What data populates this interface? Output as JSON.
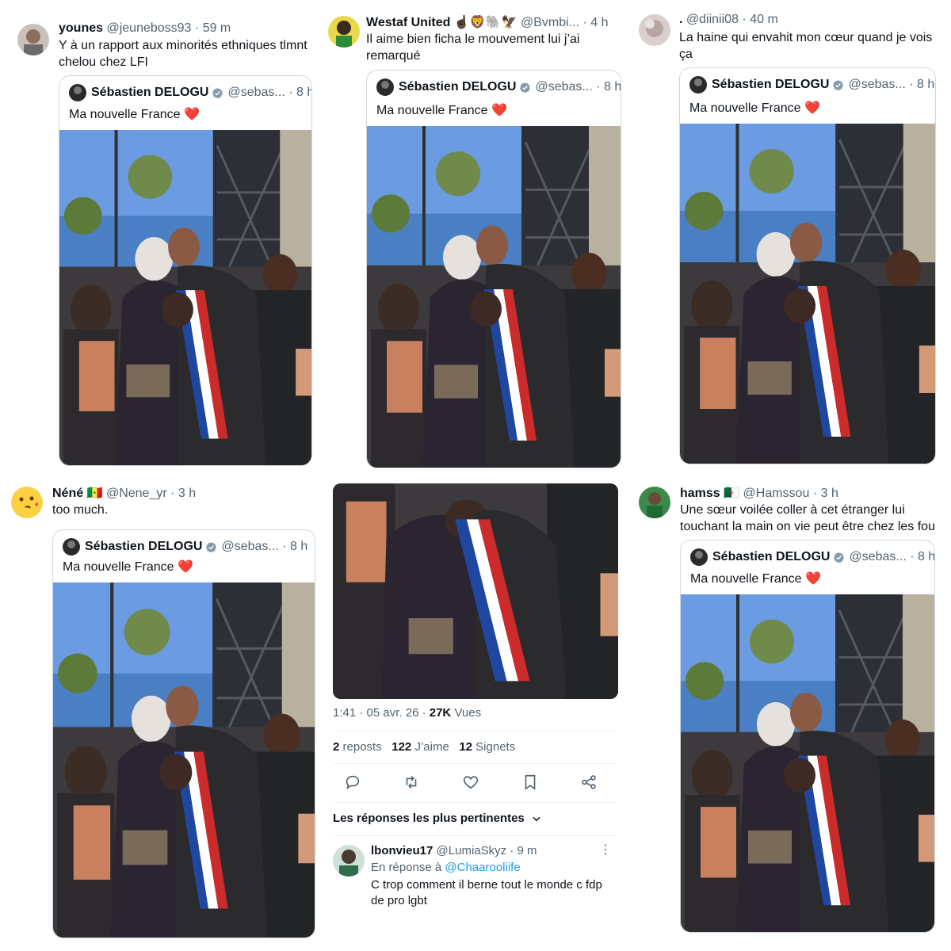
{
  "quoted_tweet": {
    "author_name": "Sébastien DELOGU",
    "handle": "@sebas...",
    "time": "8 h",
    "text": "Ma nouvelle France",
    "emoji": "❤️"
  },
  "replies": [
    {
      "name": "younes",
      "handle": "@jeuneboss93",
      "time": "59 m",
      "text": "Y à un rapport aux minorités ethniques tlmnt chelou chez LFI"
    },
    {
      "name": "Westaf United",
      "flags": "☝🏿🦁🐘🦅",
      "handle": "@Bvmbi...",
      "time": "4 h",
      "text": "Il aime bien ficha le mouvement lui j’ai remarqué"
    },
    {
      "name": ".",
      "handle": "@diinii08",
      "time": "40 m",
      "text": "La haine qui envahit mon cœur quand je vois ça"
    },
    {
      "name": "Néné",
      "flags": "🇸🇳",
      "handle": "@Nene_yr",
      "time": "3 h",
      "text": "too much."
    },
    {
      "name": "hamss",
      "flags": "🇩🇿",
      "handle": "@Hamssou",
      "time": "3 h",
      "text": "Une sœur voilée coller à cet étranger lui touchant la main on vie peut être chez les fou"
    }
  ],
  "detail": {
    "timestamp": "1:41 · 05 avr. 26 ·",
    "views_count": "27K",
    "views_label": "Vues",
    "reposts_count": "2",
    "reposts_label": "reposts",
    "likes_count": "122",
    "likes_label": "J’aime",
    "bookmarks_count": "12",
    "bookmarks_label": "Signets",
    "sort_label": "Les réponses les plus pertinentes",
    "reply": {
      "name": "lbonvieu17",
      "handle": "@LumiaSkyz",
      "time": "9 m",
      "reply_to_prefix": "En réponse à",
      "reply_to_handle": "@Chaarooliife",
      "text": "C trop comment il berne tout le monde c fdp de pro lgbt"
    }
  },
  "icons": {
    "reply": "reply-icon",
    "repost": "repost-icon",
    "like": "heart-icon",
    "bookmark": "bookmark-icon",
    "share": "share-icon",
    "verified": "verified-badge-icon",
    "more": "more-icon"
  },
  "colors": {
    "verified_badge": "#829aab",
    "link": "#1d9bf0",
    "secondary_text": "#536471",
    "heart": "#e0245e"
  }
}
